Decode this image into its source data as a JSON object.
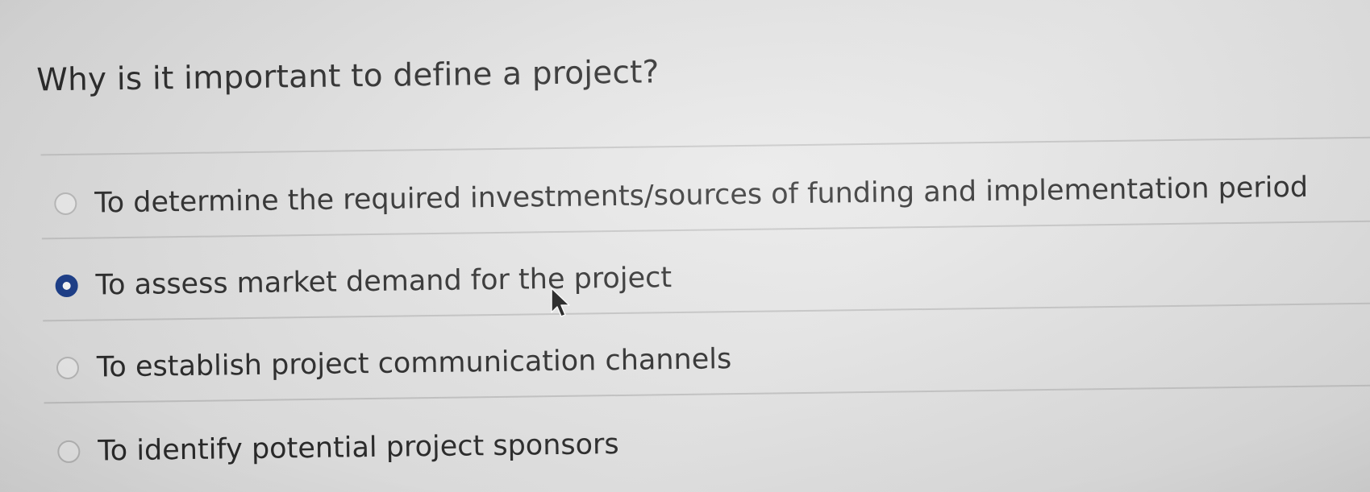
{
  "question": {
    "text": "Why is it important to define a project?"
  },
  "options": [
    {
      "label": "To determine the required investments/sources of funding and implementation period",
      "selected": false
    },
    {
      "label": "To assess market demand for the project",
      "selected": true
    },
    {
      "label": "To establish project communication channels",
      "selected": false
    },
    {
      "label": "To identify potential project sponsors",
      "selected": false
    }
  ],
  "colors": {
    "selected_radio": "#1c3f8c",
    "divider": "#c6c6c6",
    "text": "#2c2c2c"
  },
  "icons": {
    "cursor": "mouse-pointer-arrow-icon"
  }
}
